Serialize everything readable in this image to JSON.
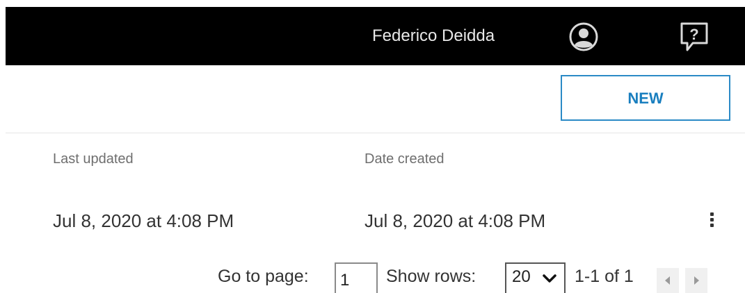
{
  "header": {
    "user_name": "Federico Deidda",
    "icons": [
      "account-circle-icon",
      "help-icon"
    ]
  },
  "toolbar": {
    "new_label": "NEW"
  },
  "table": {
    "columns": [
      "Last updated",
      "Date created"
    ],
    "rows": [
      {
        "last_updated": "Jul 8, 2020 at 4:08 PM",
        "date_created": "Jul 8, 2020 at 4:08 PM",
        "menu_icon": "more-vertical-icon"
      }
    ]
  },
  "pagination": {
    "goto_label": "Go to page:",
    "page_value": "1",
    "rows_label": "Show rows:",
    "rows_selected": "20",
    "range_text": "1-1 of 1",
    "prev_icon": "chevron-left-icon",
    "next_icon": "chevron-right-icon"
  },
  "colors": {
    "header_bg": "#000000",
    "accent": "#1a7fbf"
  }
}
